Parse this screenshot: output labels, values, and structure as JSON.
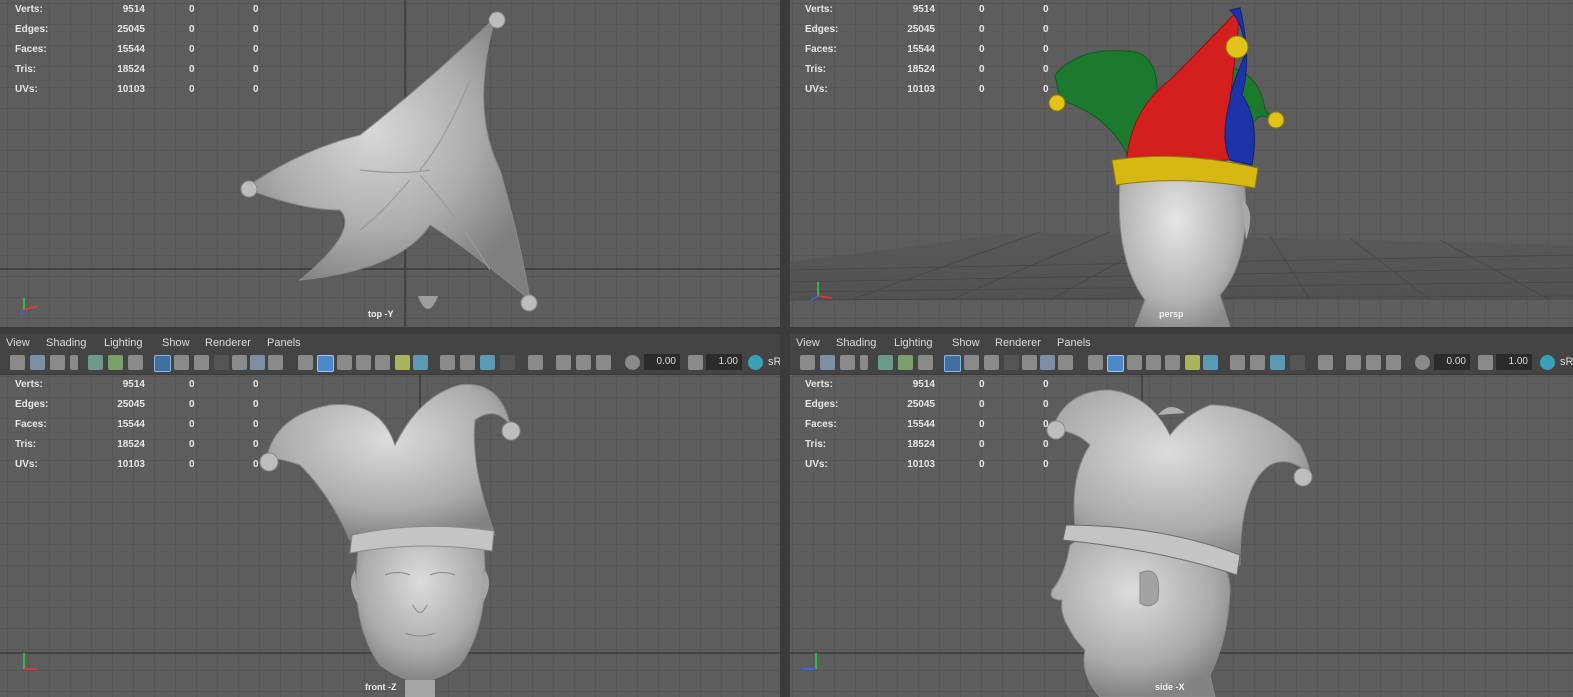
{
  "stats_labels": [
    "Verts:",
    "Edges:",
    "Faces:",
    "Tris:",
    "UVs:"
  ],
  "stats_values": [
    "9514",
    "25045",
    "15544",
    "18524",
    "10103"
  ],
  "stats_zero": "0",
  "viewports": {
    "top": {
      "label": "top -Y"
    },
    "persp": {
      "label": "persp"
    },
    "front": {
      "label": "front -Z"
    },
    "side": {
      "label": "side -X"
    }
  },
  "panel_menu": {
    "items": [
      "View",
      "Shading",
      "Lighting",
      "Show",
      "Renderer",
      "Panels"
    ]
  },
  "panel_toolbar": {
    "field1": "0.00",
    "field2": "1.00",
    "srgb": "sR"
  },
  "colors": {
    "viewport_bg": "#5d5d5d",
    "grid_line": "#4a4a4a",
    "hat_red": "#d41f1f",
    "hat_green": "#1c7a2e",
    "hat_blue": "#1d34a8",
    "hat_gold": "#d6b713",
    "clay": "#b8b8b8"
  }
}
